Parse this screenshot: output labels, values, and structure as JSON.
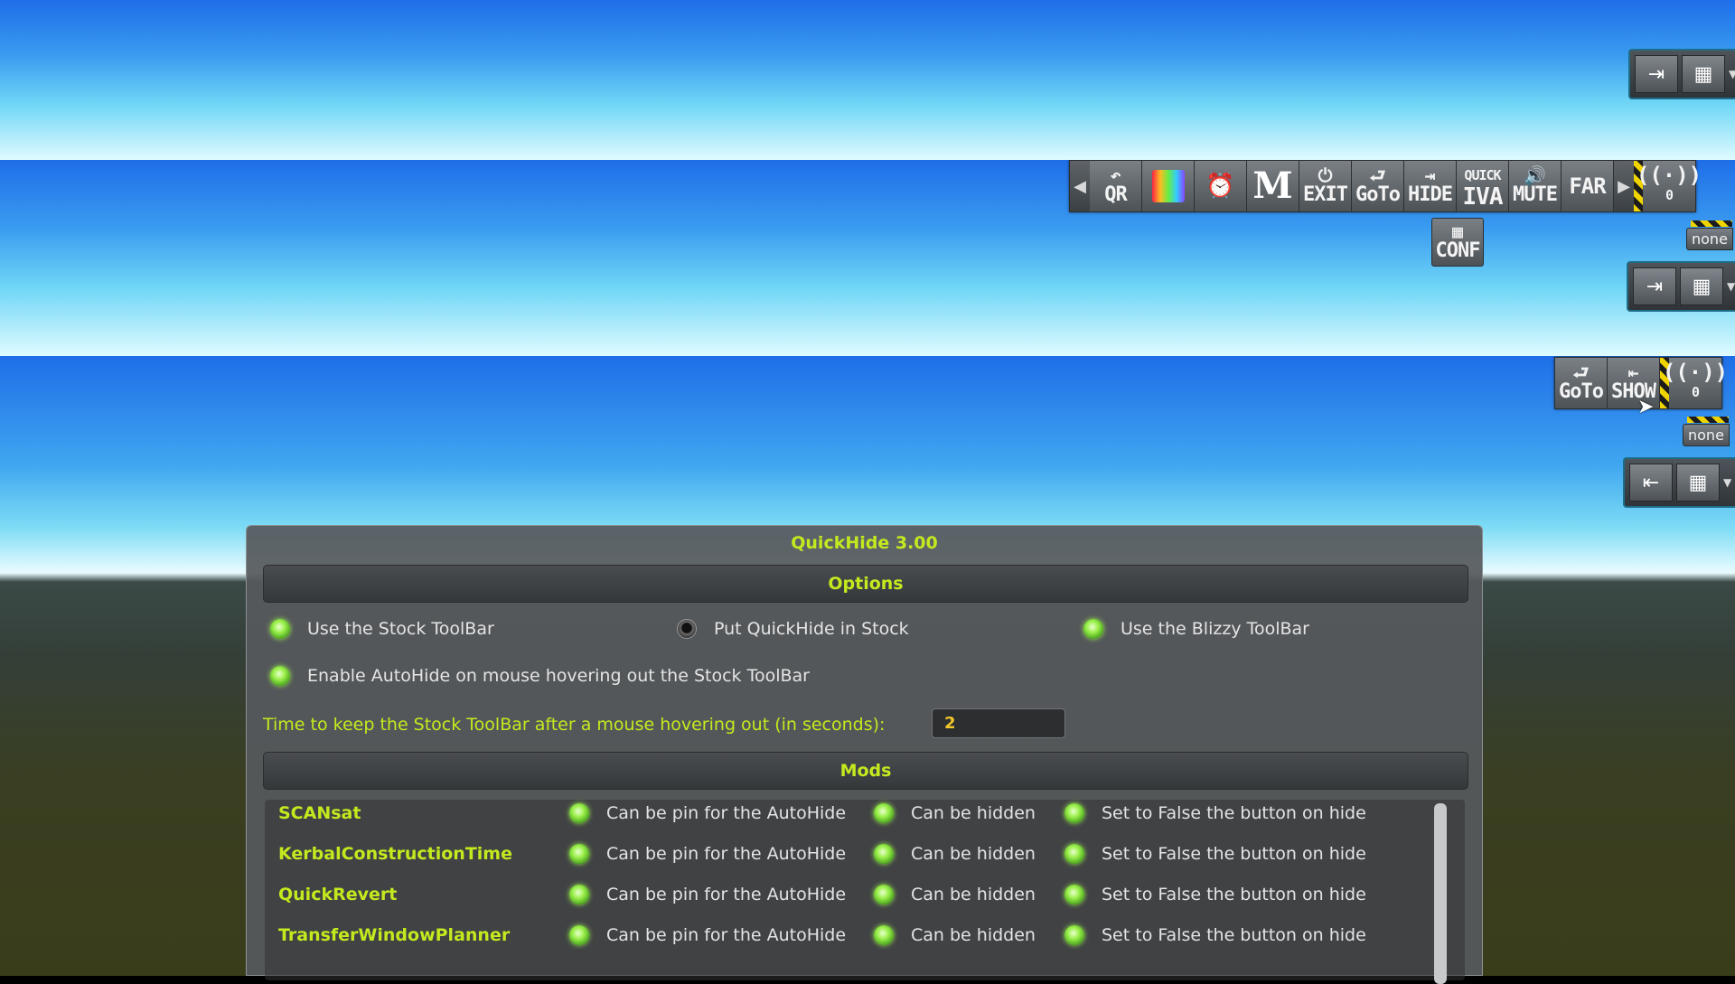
{
  "toolbar_main": {
    "buttons": [
      {
        "icon": "↶",
        "label": "QR",
        "name": "quickrevert"
      },
      {
        "icon": "",
        "label": "",
        "name": "scansat"
      },
      {
        "icon": "⏰",
        "label": "",
        "name": "alarm-clock"
      },
      {
        "icon": "",
        "label": "M",
        "name": "mechjeb"
      },
      {
        "icon": "⏻",
        "label": "EXIT",
        "name": "exit"
      },
      {
        "icon": "⮐",
        "label": "GoTo",
        "name": "goto"
      },
      {
        "icon": "⇥",
        "label": "HIDE",
        "name": "hide"
      },
      {
        "icon": "QUICK",
        "label": "IVA",
        "name": "quick-iva"
      },
      {
        "icon": "🔊",
        "label": "MUTE",
        "name": "mute"
      },
      {
        "icon": "",
        "label": "FAR",
        "name": "far"
      }
    ],
    "conf": {
      "icon": "▦",
      "label": "CONF"
    },
    "antenna_count": "0",
    "none_label": "none"
  },
  "toolbar_show": {
    "buttons": [
      {
        "icon": "⮐",
        "label": "GoTo",
        "name": "goto"
      },
      {
        "icon": "⇤",
        "label": "SHOW",
        "name": "show"
      }
    ],
    "antenna_count": "0",
    "none_label": "none"
  },
  "window": {
    "title": "QuickHide 3.00",
    "options_header": "Options",
    "use_stock": "Use the Stock ToolBar",
    "put_in_stock": "Put QuickHide in Stock",
    "use_blizzy": "Use the Blizzy ToolBar",
    "enable_autohide": "Enable AutoHide on mouse hovering out the Stock ToolBar",
    "timer_label": "Time to keep the Stock ToolBar after a mouse hovering out (in seconds):",
    "timer_value": "2",
    "mods_header": "Mods",
    "mods": [
      {
        "name": "SCANsat",
        "pin": "Can be pin for the AutoHide",
        "hidden": "Can be hidden",
        "false_on_hide": "Set to False the button on hide"
      },
      {
        "name": "KerbalConstructionTime",
        "pin": "Can be pin for the AutoHide",
        "hidden": "Can be hidden",
        "false_on_hide": "Set to False the button on hide"
      },
      {
        "name": "QuickRevert",
        "pin": "Can be pin for the AutoHide",
        "hidden": "Can be hidden",
        "false_on_hide": "Set to False the button on hide"
      },
      {
        "name": "TransferWindowPlanner",
        "pin": "Can be pin for the AutoHide",
        "hidden": "Can be hidden",
        "false_on_hide": "Set to False the button on hide"
      }
    ]
  },
  "colors": {
    "accent": "#c3ea1e",
    "led_on": "#9cf04c",
    "timer_text": "#f0c82a"
  }
}
